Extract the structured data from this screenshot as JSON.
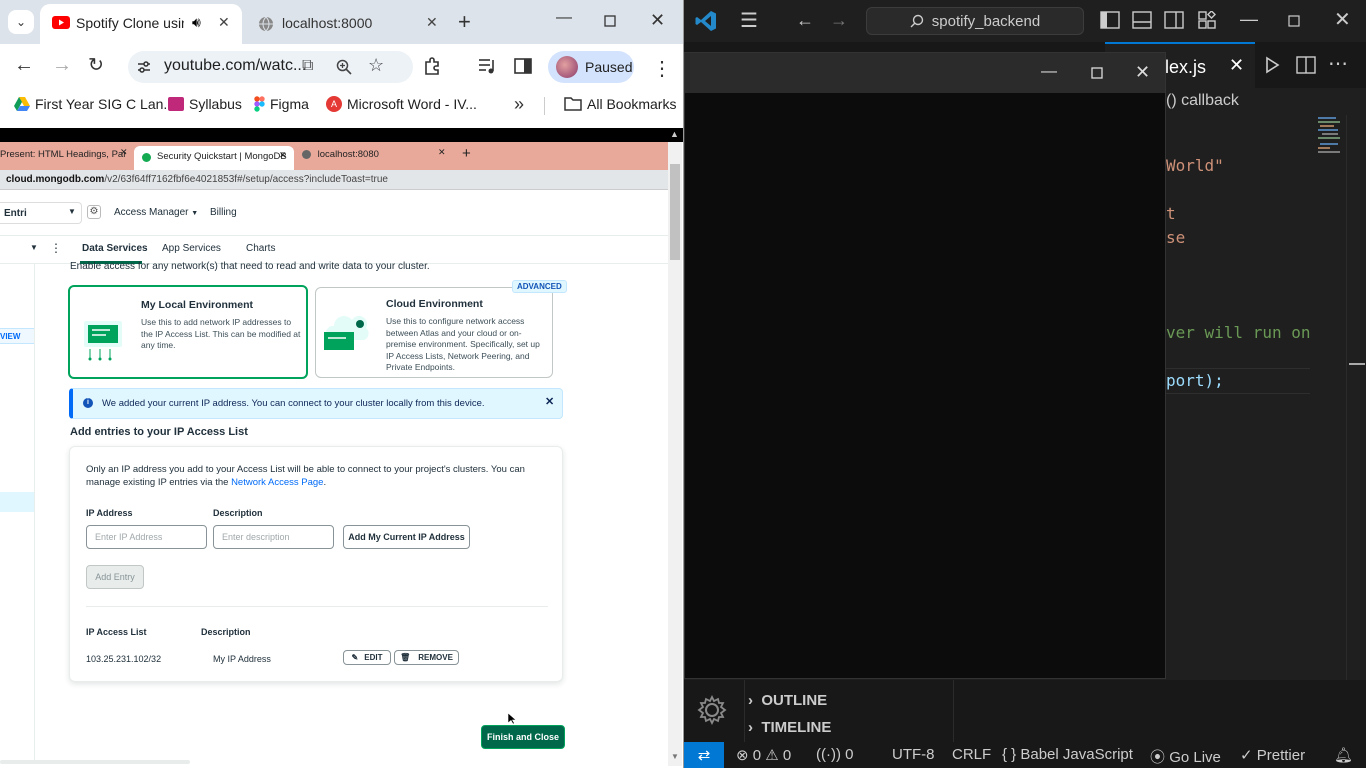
{
  "chrome": {
    "tabs": [
      {
        "title": "Spotify Clone using",
        "favicon": "youtube-icon",
        "audio": true
      },
      {
        "title": "localhost:8000",
        "favicon": "globe-icon"
      }
    ],
    "url": "youtube.com/watc...",
    "profile_status": "Paused",
    "bookmarks": [
      {
        "label": "First Year SIG C Lan...",
        "icon": "drive-icon"
      },
      {
        "label": "Syllabus",
        "icon": "syllabus-icon"
      },
      {
        "label": "Figma",
        "icon": "figma-icon"
      },
      {
        "label": "Microsoft Word - IV...",
        "icon": "pdf-icon"
      }
    ],
    "all_bookmarks": "All Bookmarks"
  },
  "inner_browser": {
    "tabs": [
      {
        "title": "Present: HTML Headings, Para"
      },
      {
        "title": "Security Quickstart | MongoDB"
      },
      {
        "title": "localhost:8080"
      }
    ],
    "url_host": "cloud.mongodb.com",
    "url_path": "/v2/63f64ff7162fbf6e4021853f#/setup/access?includeToast=true"
  },
  "atlas": {
    "org": "Entri",
    "nav": {
      "access_manager": "Access Manager",
      "billing": "Billing"
    },
    "tabs": [
      "Data Services",
      "App Services",
      "Charts"
    ],
    "side_label": "VIEW",
    "intro": "Enable access for any network(s) that need to read and write data to your cluster.",
    "env_local": {
      "title": "My Local Environment",
      "desc": "Use this to add network IP addresses to the IP Access List. This can be modified at any time."
    },
    "env_cloud": {
      "title": "Cloud Environment",
      "badge": "ADVANCED",
      "desc": "Use this to configure network access between Atlas and your cloud or on-premise environment. Specifically, set up IP Access Lists, Network Peering, and Private Endpoints."
    },
    "toast": "We added your current IP address. You can connect to your cluster locally from this device.",
    "section_title": "Add entries to your IP Access List",
    "card_text": "Only an IP address you add to your Access List will be able to connect to your project's clusters. You can manage existing IP entries via the",
    "card_link": "Network Access Page",
    "ip_label": "IP Address",
    "desc_label": "Description",
    "ip_placeholder": "Enter IP Address",
    "desc_placeholder": "Enter description",
    "add_current_ip": "Add My Current IP Address",
    "add_entry": "Add Entry",
    "list_header": "IP Access List",
    "list_desc_header": "Description",
    "entries": [
      {
        "ip": "103.25.231.102/32",
        "description": "My IP Address"
      }
    ],
    "edit": "EDIT",
    "remove": "REMOVE",
    "finish": "Finish and Close"
  },
  "vscode": {
    "search": "spotify_backend",
    "tab": "lex.js",
    "breadcrumb": "() callback",
    "code_lines": [
      {
        "text": "World\"",
        "color": "#ce9178"
      },
      {
        "text": "t",
        "color": "#ce9178"
      },
      {
        "text": "se",
        "color": "#ce9178"
      },
      {
        "text": "ver will run on",
        "color": "#6a9955"
      },
      {
        "text": "port);",
        "color": "#9cdcfe"
      }
    ],
    "panels": [
      "OUTLINE",
      "TIMELINE"
    ],
    "status": {
      "errors": "0",
      "warnings": "0",
      "ports": "0",
      "encoding": "UTF-8",
      "eol": "CRLF",
      "language": "Babel JavaScript",
      "live": "Go Live",
      "formatter": "Prettier"
    }
  },
  "colors": {
    "mongodb_green": "#00684a",
    "link_blue": "#016bf8",
    "vscode_accent": "#0078d4",
    "chrome_tabstrip": "#dde3ea"
  }
}
